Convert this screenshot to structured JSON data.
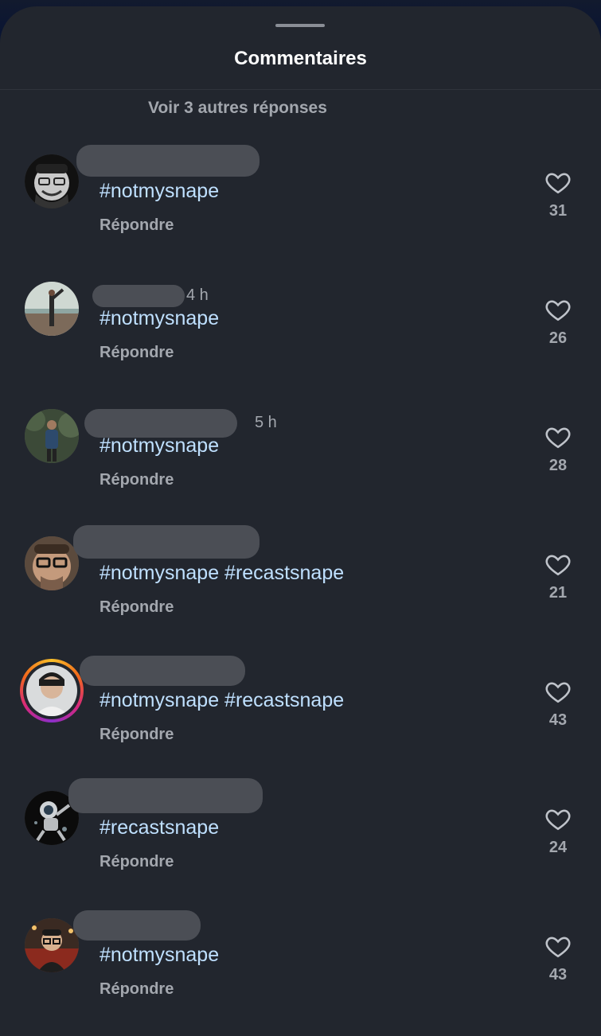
{
  "sheet": {
    "title": "Commentaires",
    "more_replies": "Voir 3 autres réponses"
  },
  "comments": [
    {
      "time": "",
      "text": "#notmysnape",
      "reply": "Répondre",
      "likes": "31",
      "avatar": "avatar-bw-man-glasses"
    },
    {
      "time": "4 h",
      "text": "#notmysnape",
      "reply": "Répondre",
      "likes": "26",
      "avatar": "avatar-yoga-pose"
    },
    {
      "time": "5 h",
      "text": "#notmysnape",
      "reply": "Répondre",
      "likes": "28",
      "avatar": "avatar-man-forest"
    },
    {
      "time": "",
      "text": "#notmysnape #recastsnape",
      "reply": "Répondre",
      "likes": "21",
      "avatar": "avatar-man-glasses"
    },
    {
      "time": "",
      "text": "#notmysnape #recastsnape",
      "reply": "Répondre",
      "likes": "43",
      "avatar": "avatar-story-portrait"
    },
    {
      "time": "",
      "text": "#recastsnape",
      "reply": "Répondre",
      "likes": "24",
      "avatar": "avatar-astronaut"
    },
    {
      "time": "",
      "text": "#notmysnape",
      "reply": "Répondre",
      "likes": "43",
      "avatar": "avatar-man-red-bg"
    }
  ],
  "colors": {
    "background": "#22262e",
    "hashtag": "#bfe0ff",
    "muted": "#a3a7ae"
  },
  "icons": {
    "like": "heart-outline-icon"
  }
}
